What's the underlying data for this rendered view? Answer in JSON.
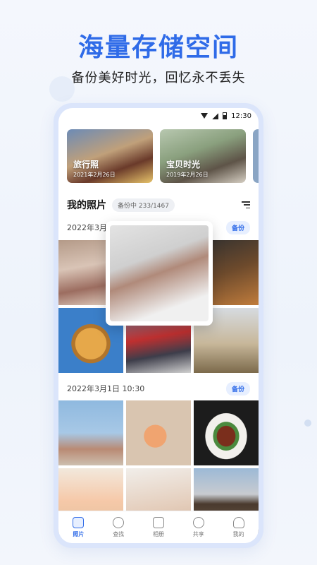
{
  "hero": {
    "title": "海量存储空间",
    "subtitle": "备份美好时光，回忆永不丢失"
  },
  "status_bar": {
    "time": "12:30"
  },
  "albums": [
    {
      "label": "旅行照",
      "date": "2021年2月26日"
    },
    {
      "label": "宝贝时光",
      "date": "2019年2月26日"
    }
  ],
  "photos_section": {
    "title": "我的照片",
    "backup_status": "备份中 233/1467"
  },
  "date_groups": [
    {
      "date": "2022年3月1",
      "action": "备份"
    },
    {
      "date": "2022年3月1日 10:30",
      "action": "备份"
    }
  ],
  "tabs": [
    {
      "label": "照片",
      "icon": "photo-icon",
      "active": true
    },
    {
      "label": "查找",
      "icon": "search-icon",
      "active": false
    },
    {
      "label": "相册",
      "icon": "album-icon",
      "active": false
    },
    {
      "label": "共享",
      "icon": "share-icon",
      "active": false
    },
    {
      "label": "我的",
      "icon": "user-icon",
      "active": false
    }
  ],
  "colors": {
    "accent": "#2f6be8",
    "background": "#f4f7fd"
  }
}
